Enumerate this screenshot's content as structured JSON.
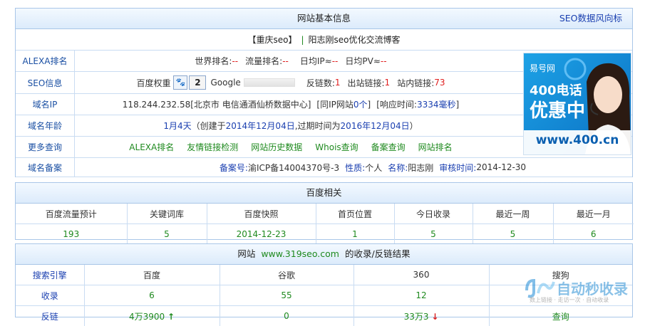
{
  "site_info": {
    "title": "网站基本信息",
    "right_link": "SEO数据风向标",
    "site_line": {
      "name": "【重庆seo】",
      "sep": "|",
      "desc": "阳志刚seo优化交流博客"
    },
    "rows": [
      {
        "label": "ALEXA排名",
        "world_label": "世界排名:",
        "world_value": "--",
        "traffic_label": "流量排名:",
        "traffic_value": "--",
        "ip_label": "日均IP≈",
        "ip_value": "--",
        "pv_label": "日均PV≈",
        "pv_value": "--"
      },
      {
        "label": "SEO信息",
        "baidu_weight_label": "百度权重",
        "baidu_weight_icon": "paw-icon",
        "baidu_weight_value": "2",
        "google_label": "Google",
        "backlinks_label": "反链数:",
        "backlinks_value": "1",
        "outlinks_label": "出站链接:",
        "outlinks_value": "1",
        "inlinks_label": "站内链接:",
        "inlinks_value": "73"
      },
      {
        "label": "域名IP",
        "ip": "118.244.232.58",
        "location": "[北京市 电信通酒仙桥数据中心]",
        "same_ip_prefix": "[同IP网站",
        "same_ip_count": "0个",
        "same_ip_suffix": "]",
        "response_prefix": "[响应时间:",
        "response_value": "3334毫秒",
        "response_suffix": "]"
      },
      {
        "label": "域名年龄",
        "age": "1月4天",
        "created_prefix": "（创建于",
        "created_date": "2014年12月04日",
        "expire_prefix": ",过期时间为",
        "expire_date": "2016年12月04日",
        "suffix": "）"
      },
      {
        "label": "更多查询",
        "links": [
          "ALEXA排名",
          "友情链接检测",
          "网站历史数据",
          "Whois查询",
          "备案查询",
          "网站排名"
        ]
      },
      {
        "label": "域名备案",
        "beian_label": "备案号:",
        "beian_value": "渝ICP备14004370号-3",
        "nature_label": "性质:",
        "nature_value": "个人",
        "name_label": "名称:",
        "name_value": "阳志刚",
        "audit_label": "审核时间:",
        "audit_value": "2014-12-30"
      }
    ],
    "ad": {
      "brand": "易号网",
      "line1": "400电话",
      "line2": "优惠中",
      "url": "www.400.cn"
    }
  },
  "baidu": {
    "title": "百度相关",
    "headers": [
      "百度流量预计",
      "关键词库",
      "百度快照",
      "首页位置",
      "今日收录",
      "最近一周",
      "最近一月"
    ],
    "values": [
      "193",
      "5",
      "2014-12-23",
      "1",
      "5",
      "5",
      "6"
    ]
  },
  "index": {
    "title_prefix": "网站",
    "title_site": "www.319seo.com",
    "title_suffix": "的收录/反链结果",
    "headers": [
      "搜索引擎",
      "百度",
      "谷歌",
      "360",
      "搜狗"
    ],
    "rows": [
      {
        "label": "收录",
        "values": [
          "6",
          "55",
          "12",
          ""
        ]
      },
      {
        "label": "反链",
        "values": [
          "4万3900",
          "0",
          "33万3",
          "查询"
        ]
      }
    ],
    "up_arrow": "↑",
    "down_arrow": "↓"
  },
  "watermark": {
    "text": "自动秒收录",
    "sub": "数上链接 · 走访一次 · 自动收录"
  }
}
